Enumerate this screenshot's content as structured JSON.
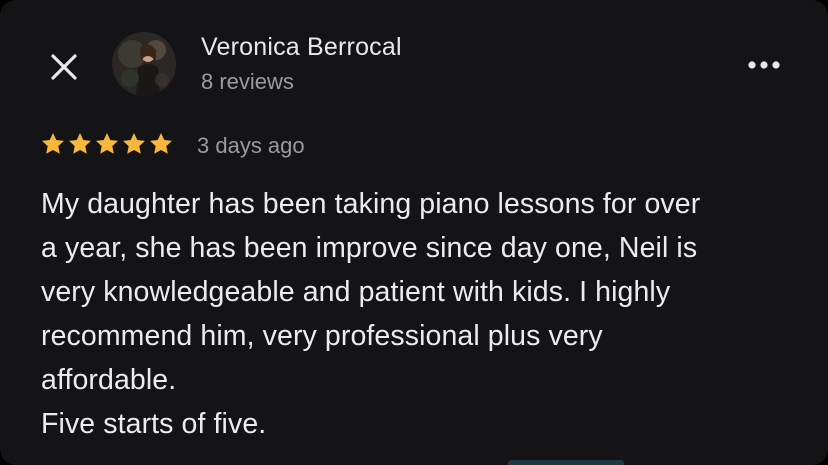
{
  "reviewer": {
    "name": "Veronica Berrocal",
    "review_count": "8 reviews"
  },
  "review": {
    "rating": 5,
    "max_rating": 5,
    "date": "3 days ago",
    "lines": [
      "My daughter has been taking piano lessons for over",
      "a year, she has been improve since day one, Neil is",
      "very knowledgeable and patient with kids. I highly",
      "recommend him, very professional plus very",
      "affordable.",
      "Five starts of five."
    ]
  },
  "icons": {
    "close": "close-icon",
    "more": "more-horizontal-icon",
    "star": "star-icon"
  },
  "colors": {
    "background": "#141416",
    "star": "#f6b73c",
    "text_primary": "#ececee",
    "text_secondary": "#9a9aa0"
  }
}
